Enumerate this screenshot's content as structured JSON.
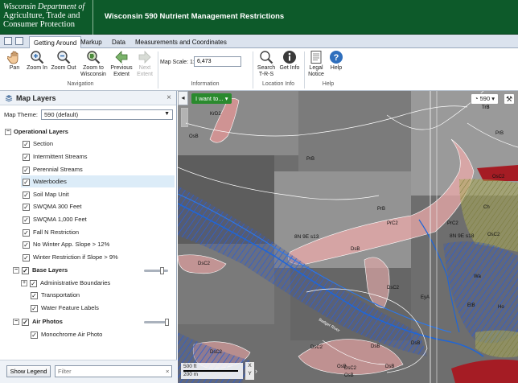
{
  "header": {
    "logo_line1": "Wisconsin Department of",
    "logo_line2": "Agriculture, Trade and",
    "logo_line3": "Consumer Protection",
    "app_title": "Wisconsin 590 Nutrient Management Restrictions",
    "brand_color": "#0d5a2a"
  },
  "tabs": [
    {
      "label": "Getting Around",
      "active": true
    },
    {
      "label": "Markup",
      "active": false
    },
    {
      "label": "Data",
      "active": false
    },
    {
      "label": "Measurements and Coordinates",
      "active": false
    }
  ],
  "ribbon": {
    "pan": "Pan",
    "zoom_in": "Zoom In",
    "zoom_out": "Zoom Out",
    "zoom_to_wisconsin_1": "Zoom to",
    "zoom_to_wisconsin_2": "Wisconsin",
    "previous_extent_1": "Previous",
    "previous_extent_2": "Extent",
    "next_extent_1": "Next",
    "next_extent_2": "Extent",
    "navigation_group": "Navigation",
    "map_scale_label": "Map Scale: 1:",
    "map_scale_value": "6,473",
    "information_group": "Information",
    "search_trs_1": "Search",
    "search_trs_2": "T-R-S",
    "get_info": "Get Info",
    "location_info_group": "Location Info",
    "legal_notice_1": "Legal",
    "legal_notice_2": "Notice",
    "help": "Help",
    "help_group": "Help"
  },
  "layers_panel": {
    "title": "Map Layers",
    "close": "×",
    "theme_label": "Map Theme:",
    "theme_value": "590 (default)",
    "operational_title": "Operational Layers",
    "operational_layers": [
      "Section",
      "Intermittent Streams",
      "Perennial Streams",
      "Waterbodies",
      "Soil Map Unit",
      "SWQMA  300 Feet",
      "SWQMA 1,000 Feet",
      "Fall N Restriction",
      "No Winter App. Slope > 12%",
      "Winter Restriction if Slope > 9%"
    ],
    "selected_layer": "Waterbodies",
    "base_title": "Base Layers",
    "base_layers": [
      "Administrative Boundaries",
      "Transportation",
      "Water Feature Labels"
    ],
    "air_title": "Air Photos",
    "air_layers": [
      "Monochrome Air Photo"
    ],
    "show_legend": "Show Legend",
    "filter_placeholder": "Filter",
    "filter_clear": "×"
  },
  "map": {
    "i_want_to": "I want to...",
    "basemap_value": "590",
    "scale_ft": "500 ft",
    "scale_m": "200 m",
    "xy_x": "X",
    "xy_y": "Y",
    "soil_labels": [
      "KrD2",
      "OsB",
      "PrB",
      "PrB",
      "PrC2",
      "PrB",
      "PrC2",
      "DsB",
      "DsC2",
      "DsC2",
      "EyA",
      "DsB",
      "DsB",
      "DsC2",
      "OsB",
      "TrB",
      "TrB",
      "OsC2",
      "Ch",
      "Wa",
      "EtB",
      "Ho",
      "OsC2",
      "DsB",
      "DsC2",
      "OsB",
      "DsC2"
    ],
    "trs_labels": [
      "8N 9E s13",
      "8N 9E s18"
    ],
    "river_label": "Badger River"
  }
}
